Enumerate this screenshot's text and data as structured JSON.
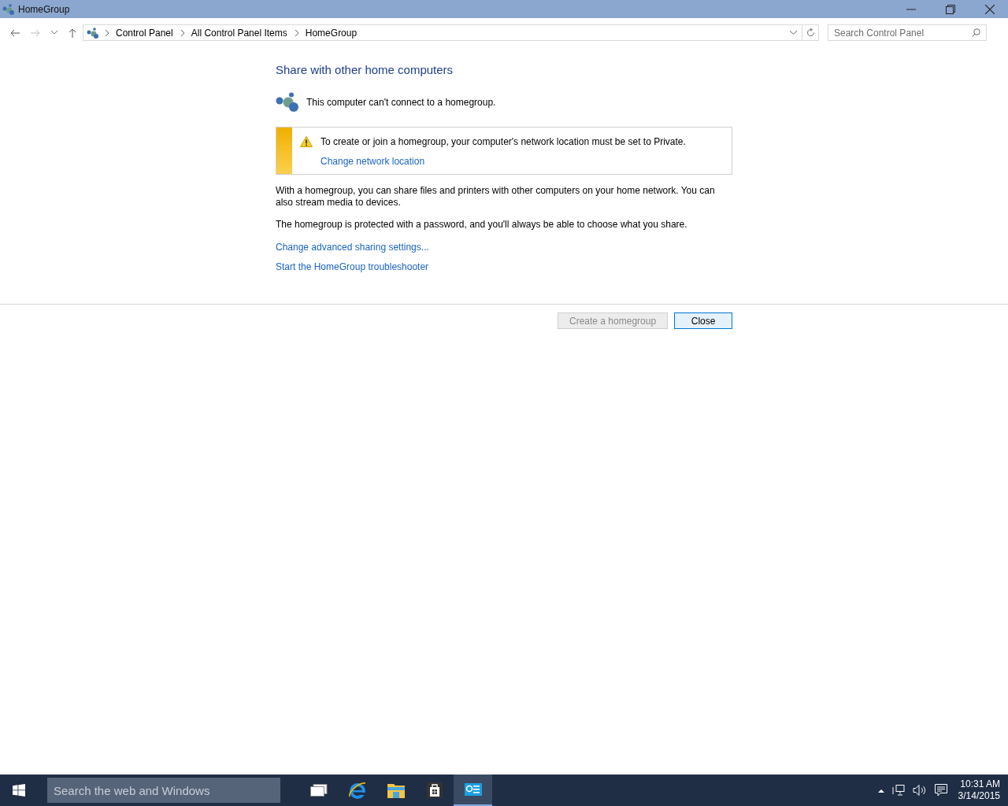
{
  "window": {
    "title": "HomeGroup"
  },
  "address_bar": {
    "breadcrumbs": [
      "Control Panel",
      "All Control Panel Items",
      "HomeGroup"
    ]
  },
  "search": {
    "placeholder": "Search Control Panel"
  },
  "heading": "Share with other home computers",
  "status": "This computer can't connect to a homegroup.",
  "warning": {
    "message": "To create or join a homegroup, your computer's network location must be set to Private.",
    "link": "Change network location"
  },
  "paragraphs": [
    "With a homegroup, you can share files and printers with other computers on your home network. You can also stream media to devices.",
    "The homegroup is protected with a password, and you'll always be able to choose what you share."
  ],
  "links": [
    "Change advanced sharing settings...",
    "Start the HomeGroup troubleshooter"
  ],
  "buttons": [
    {
      "label": "Create a homegroup",
      "disabled": true,
      "default": false
    },
    {
      "label": "Close",
      "disabled": false,
      "default": true
    }
  ],
  "taskbar": {
    "search": {
      "placeholder": "Search the web and Windows"
    },
    "apps": [
      {
        "kind": "task-view",
        "selected": false
      },
      {
        "kind": "browser",
        "selected": false
      },
      {
        "kind": "folder",
        "selected": false
      },
      {
        "kind": "store",
        "selected": false
      },
      {
        "kind": "control-panel",
        "selected": true
      }
    ],
    "time": "10:31 AM",
    "date": "3/14/2015"
  }
}
